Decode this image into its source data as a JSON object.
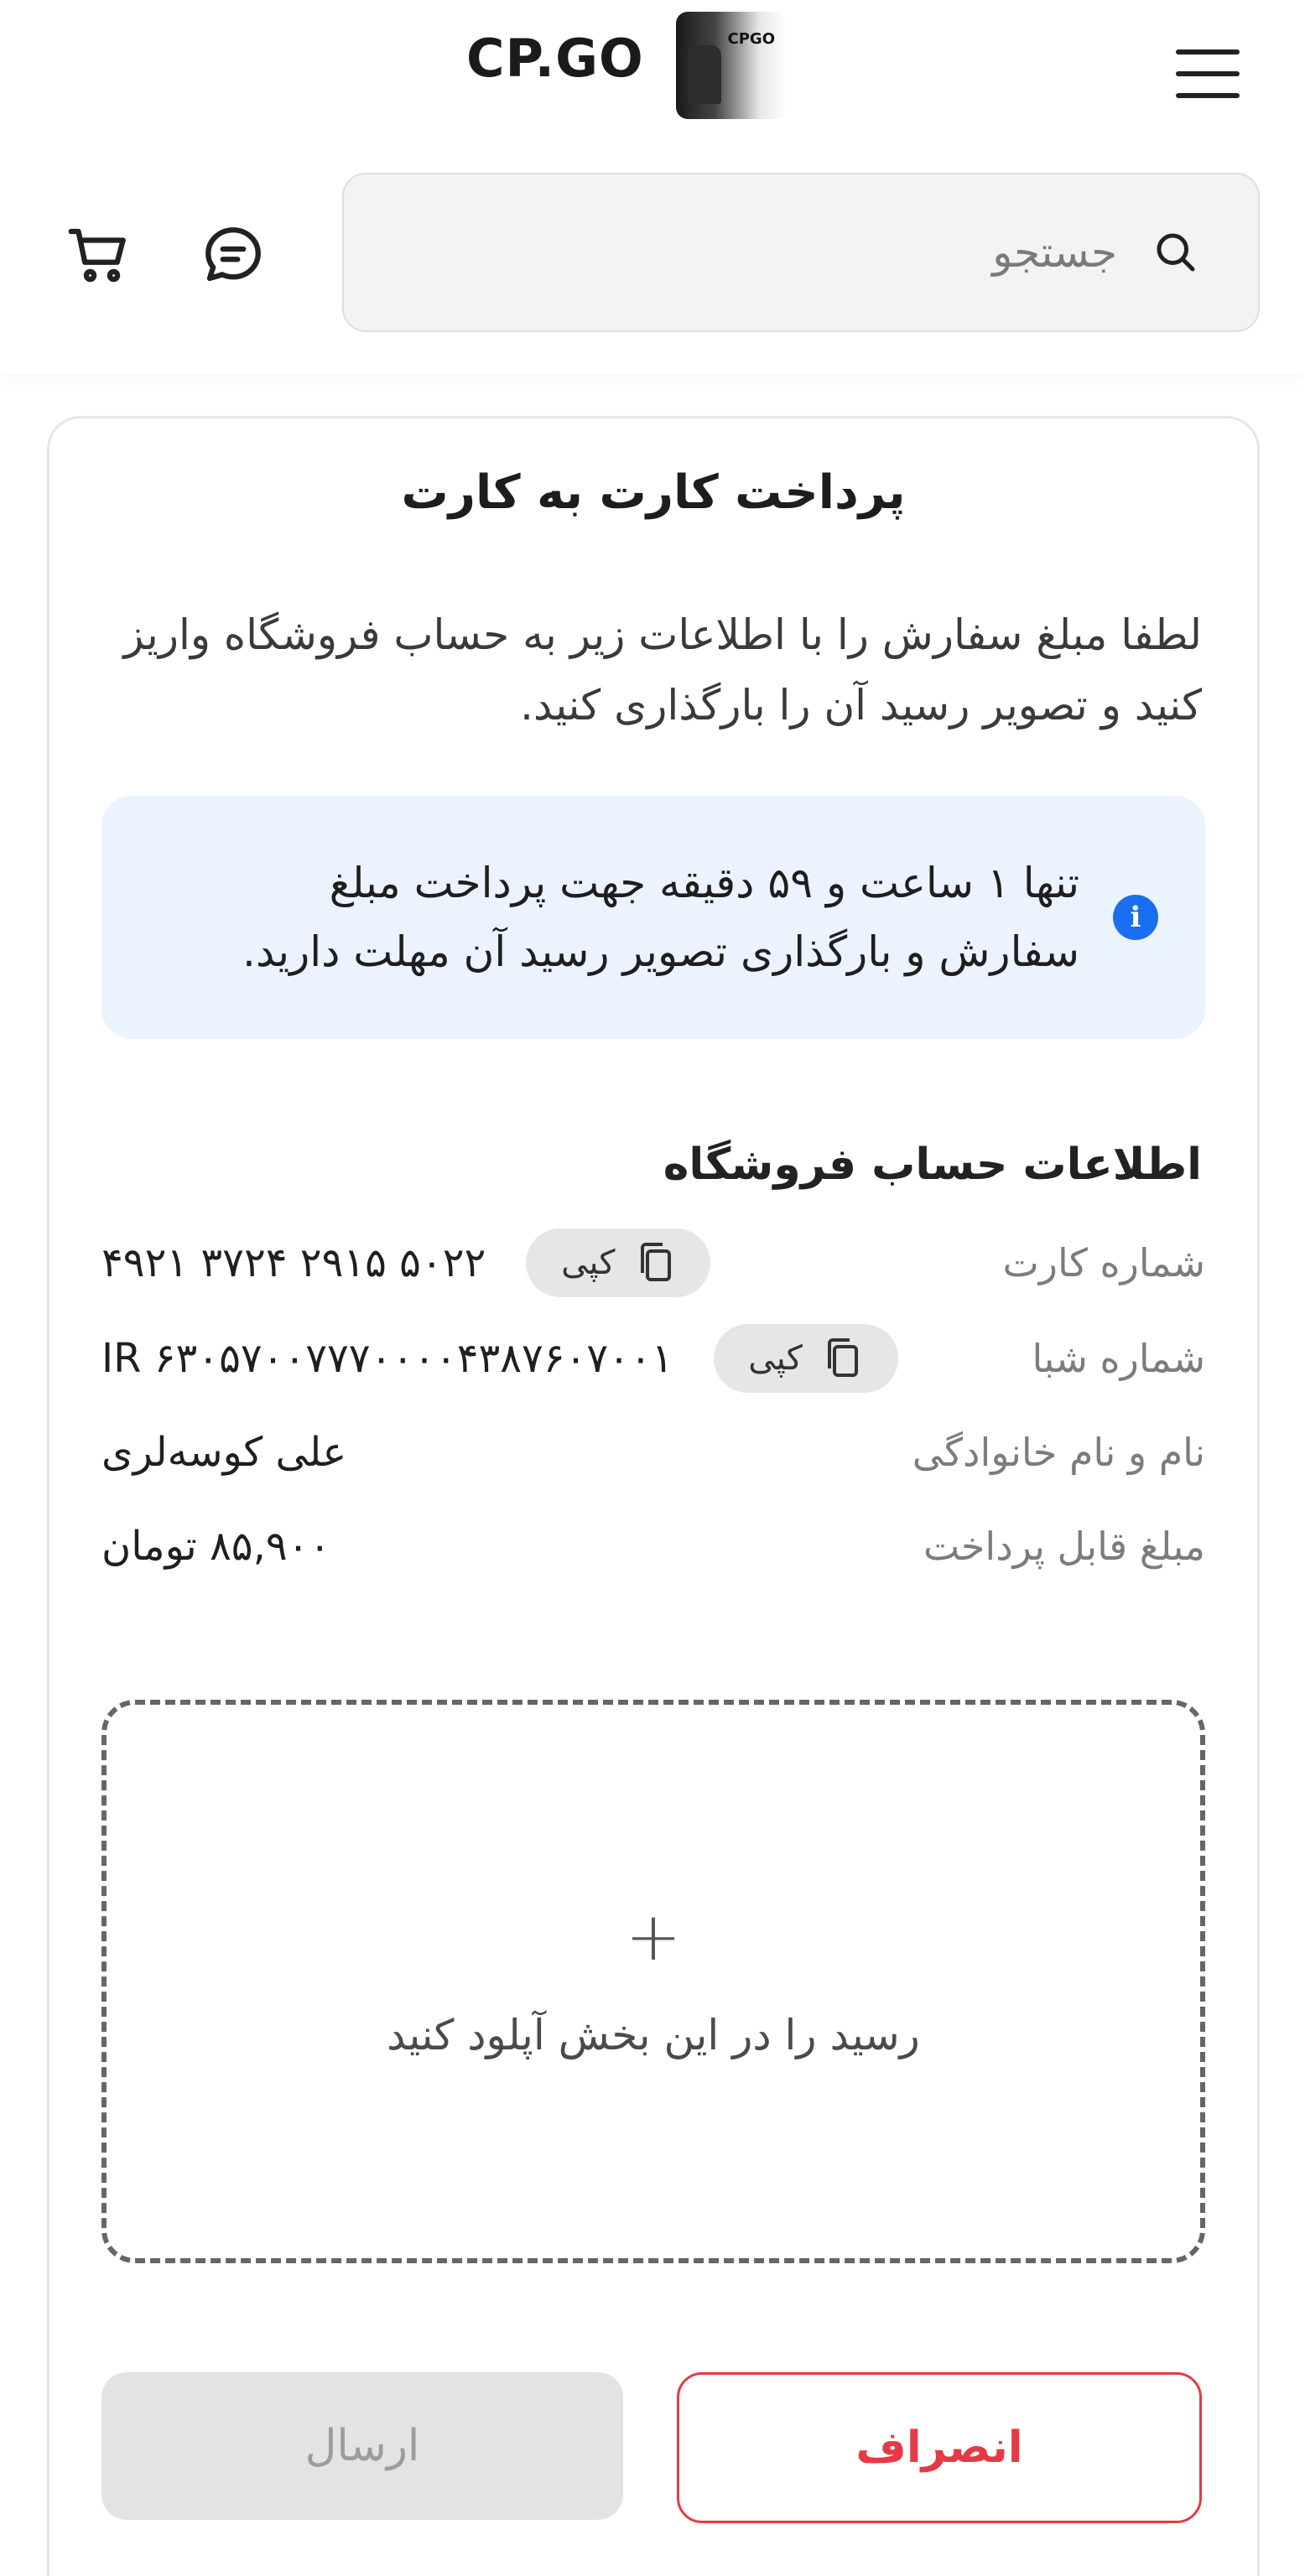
{
  "header": {
    "brand": "CP.GO",
    "logo_text": "CPGO",
    "search_placeholder": "جستجو"
  },
  "card": {
    "title": "پرداخت کارت به کارت",
    "description": "لطفا مبلغ سفارش را با اطلاعات زیر به حساب فروشگاه واریز کنید و تصویر رسید آن را بارگذاری کنید.",
    "notice": "تنها ۱ ساعت و ۵۹ دقیقه جهت پرداخت مبلغ سفارش و بارگذاری تصویر رسید آن مهلت دارید.",
    "account_section_title": "اطلاعات حساب فروشگاه",
    "rows": [
      {
        "label": "شماره کارت",
        "value": "۵۰۲۲ ۲۹۱۵ ۳۷۲۴ ۴۹۲۱",
        "copy_label": "کپی"
      },
      {
        "label": "شماره شبا",
        "value": "IR ۶۳۰۵۷۰۰۷۷۷۰۰۰۰۴۳۸۷۶۰۷۰۰۱",
        "copy_label": "کپی"
      },
      {
        "label": "نام و نام خانوادگی",
        "value": "علی کوسه‌لری"
      },
      {
        "label": "مبلغ قابل پرداخت",
        "value": "۸۵,۹۰۰ تومان"
      }
    ],
    "upload_text": "رسید را در این بخش آپلود کنید",
    "upload_plus": "+",
    "cancel_label": "انصراف",
    "send_label": "ارسال"
  },
  "colors": {
    "accent_red": "#e63946",
    "info_blue": "#1a6ef0",
    "notice_bg": "#ebf3ff"
  }
}
